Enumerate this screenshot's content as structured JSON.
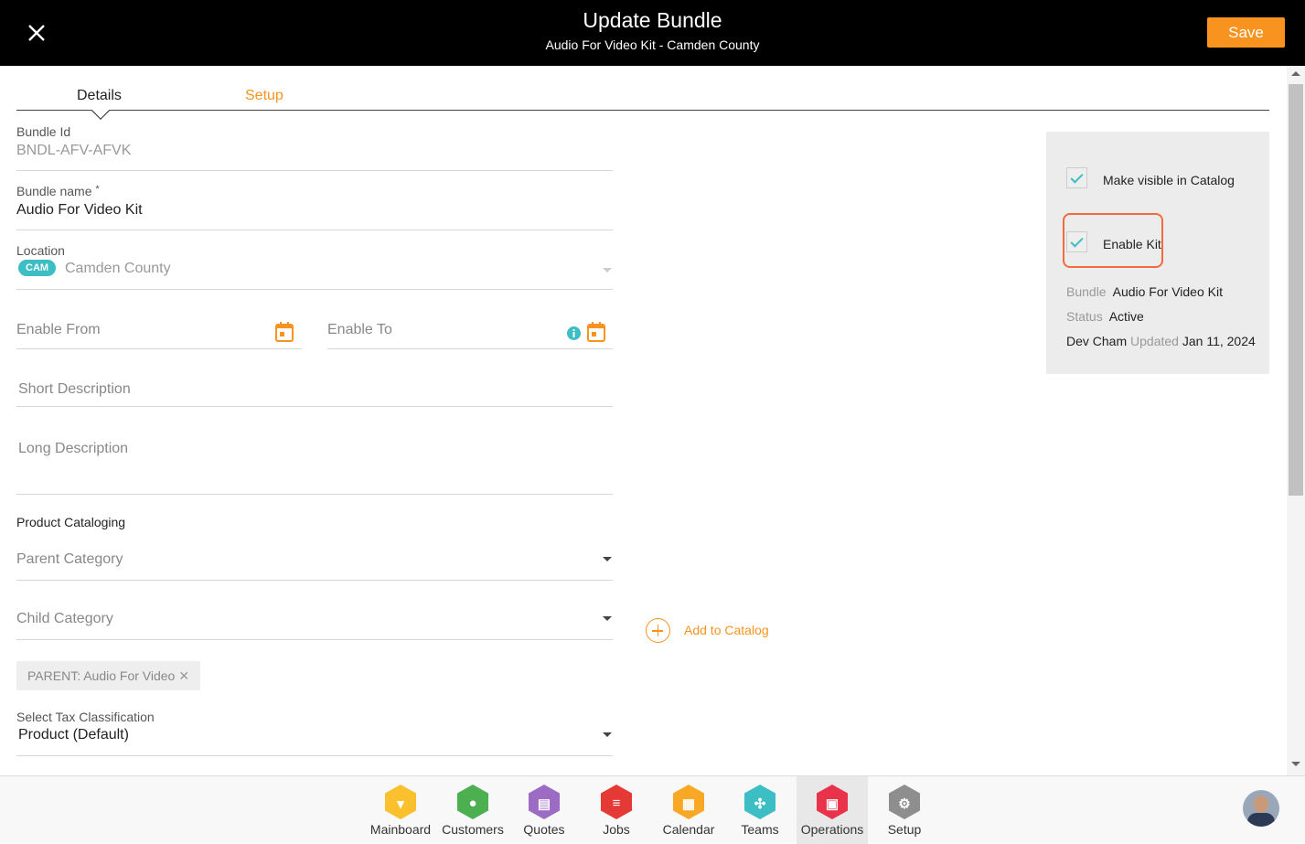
{
  "header": {
    "title": "Update Bundle",
    "subtitle": "Audio For Video Kit - Camden County",
    "save_label": "Save"
  },
  "tabs": [
    {
      "label": "Details",
      "active": true
    },
    {
      "label": "Setup",
      "active": false
    }
  ],
  "form": {
    "bundle_id": {
      "label": "Bundle Id",
      "value": "BNDL-AFV-AFVK"
    },
    "bundle_name": {
      "label": "Bundle name",
      "required": "*",
      "value": "Audio For Video Kit"
    },
    "location": {
      "label": "Location",
      "badge": "CAM",
      "value": "Camden County"
    },
    "enable_from": {
      "placeholder": "Enable From"
    },
    "enable_to": {
      "placeholder": "Enable To"
    },
    "short_description": {
      "placeholder": "Short Description"
    },
    "long_description": {
      "placeholder": "Long Description"
    },
    "product_cataloging": {
      "heading": "Product Cataloging"
    },
    "parent_category": {
      "placeholder": "Parent Category"
    },
    "child_category": {
      "placeholder": "Child Category"
    },
    "add_to_catalog_label": "Add to Catalog",
    "catalog_chip": "PARENT: Audio For Video",
    "tax": {
      "label": "Select Tax Classification",
      "value": "Product (Default)"
    }
  },
  "side_panel": {
    "make_visible": {
      "label": "Make visible in Catalog",
      "checked": true
    },
    "enable_kit": {
      "label": "Enable Kit",
      "checked": true
    },
    "bundle_key": "Bundle",
    "bundle_value": "Audio For Video Kit",
    "status_key": "Status",
    "status_value": "Active",
    "updated_by": "Dev Cham",
    "updated_key": "Updated",
    "updated_date": "Jan 11, 2024"
  },
  "bottom_nav": [
    {
      "label": "Mainboard",
      "icon": "mainboard-icon",
      "color": "#fbc02d"
    },
    {
      "label": "Customers",
      "icon": "customers-icon",
      "color": "#4caf50"
    },
    {
      "label": "Quotes",
      "icon": "quotes-icon",
      "color": "#9c6bc4"
    },
    {
      "label": "Jobs",
      "icon": "jobs-icon",
      "color": "#e53935"
    },
    {
      "label": "Calendar",
      "icon": "calendar-icon",
      "color": "#f9a825"
    },
    {
      "label": "Teams",
      "icon": "teams-icon",
      "color": "#3dbdc4"
    },
    {
      "label": "Operations",
      "icon": "operations-icon",
      "color": "#e8334a",
      "active": true
    },
    {
      "label": "Setup",
      "icon": "setup-icon",
      "color": "#8e8e8e"
    }
  ],
  "colors": {
    "accent": "#f7931e",
    "teal": "#3dbdc4",
    "highlight": "#f26b3a"
  }
}
